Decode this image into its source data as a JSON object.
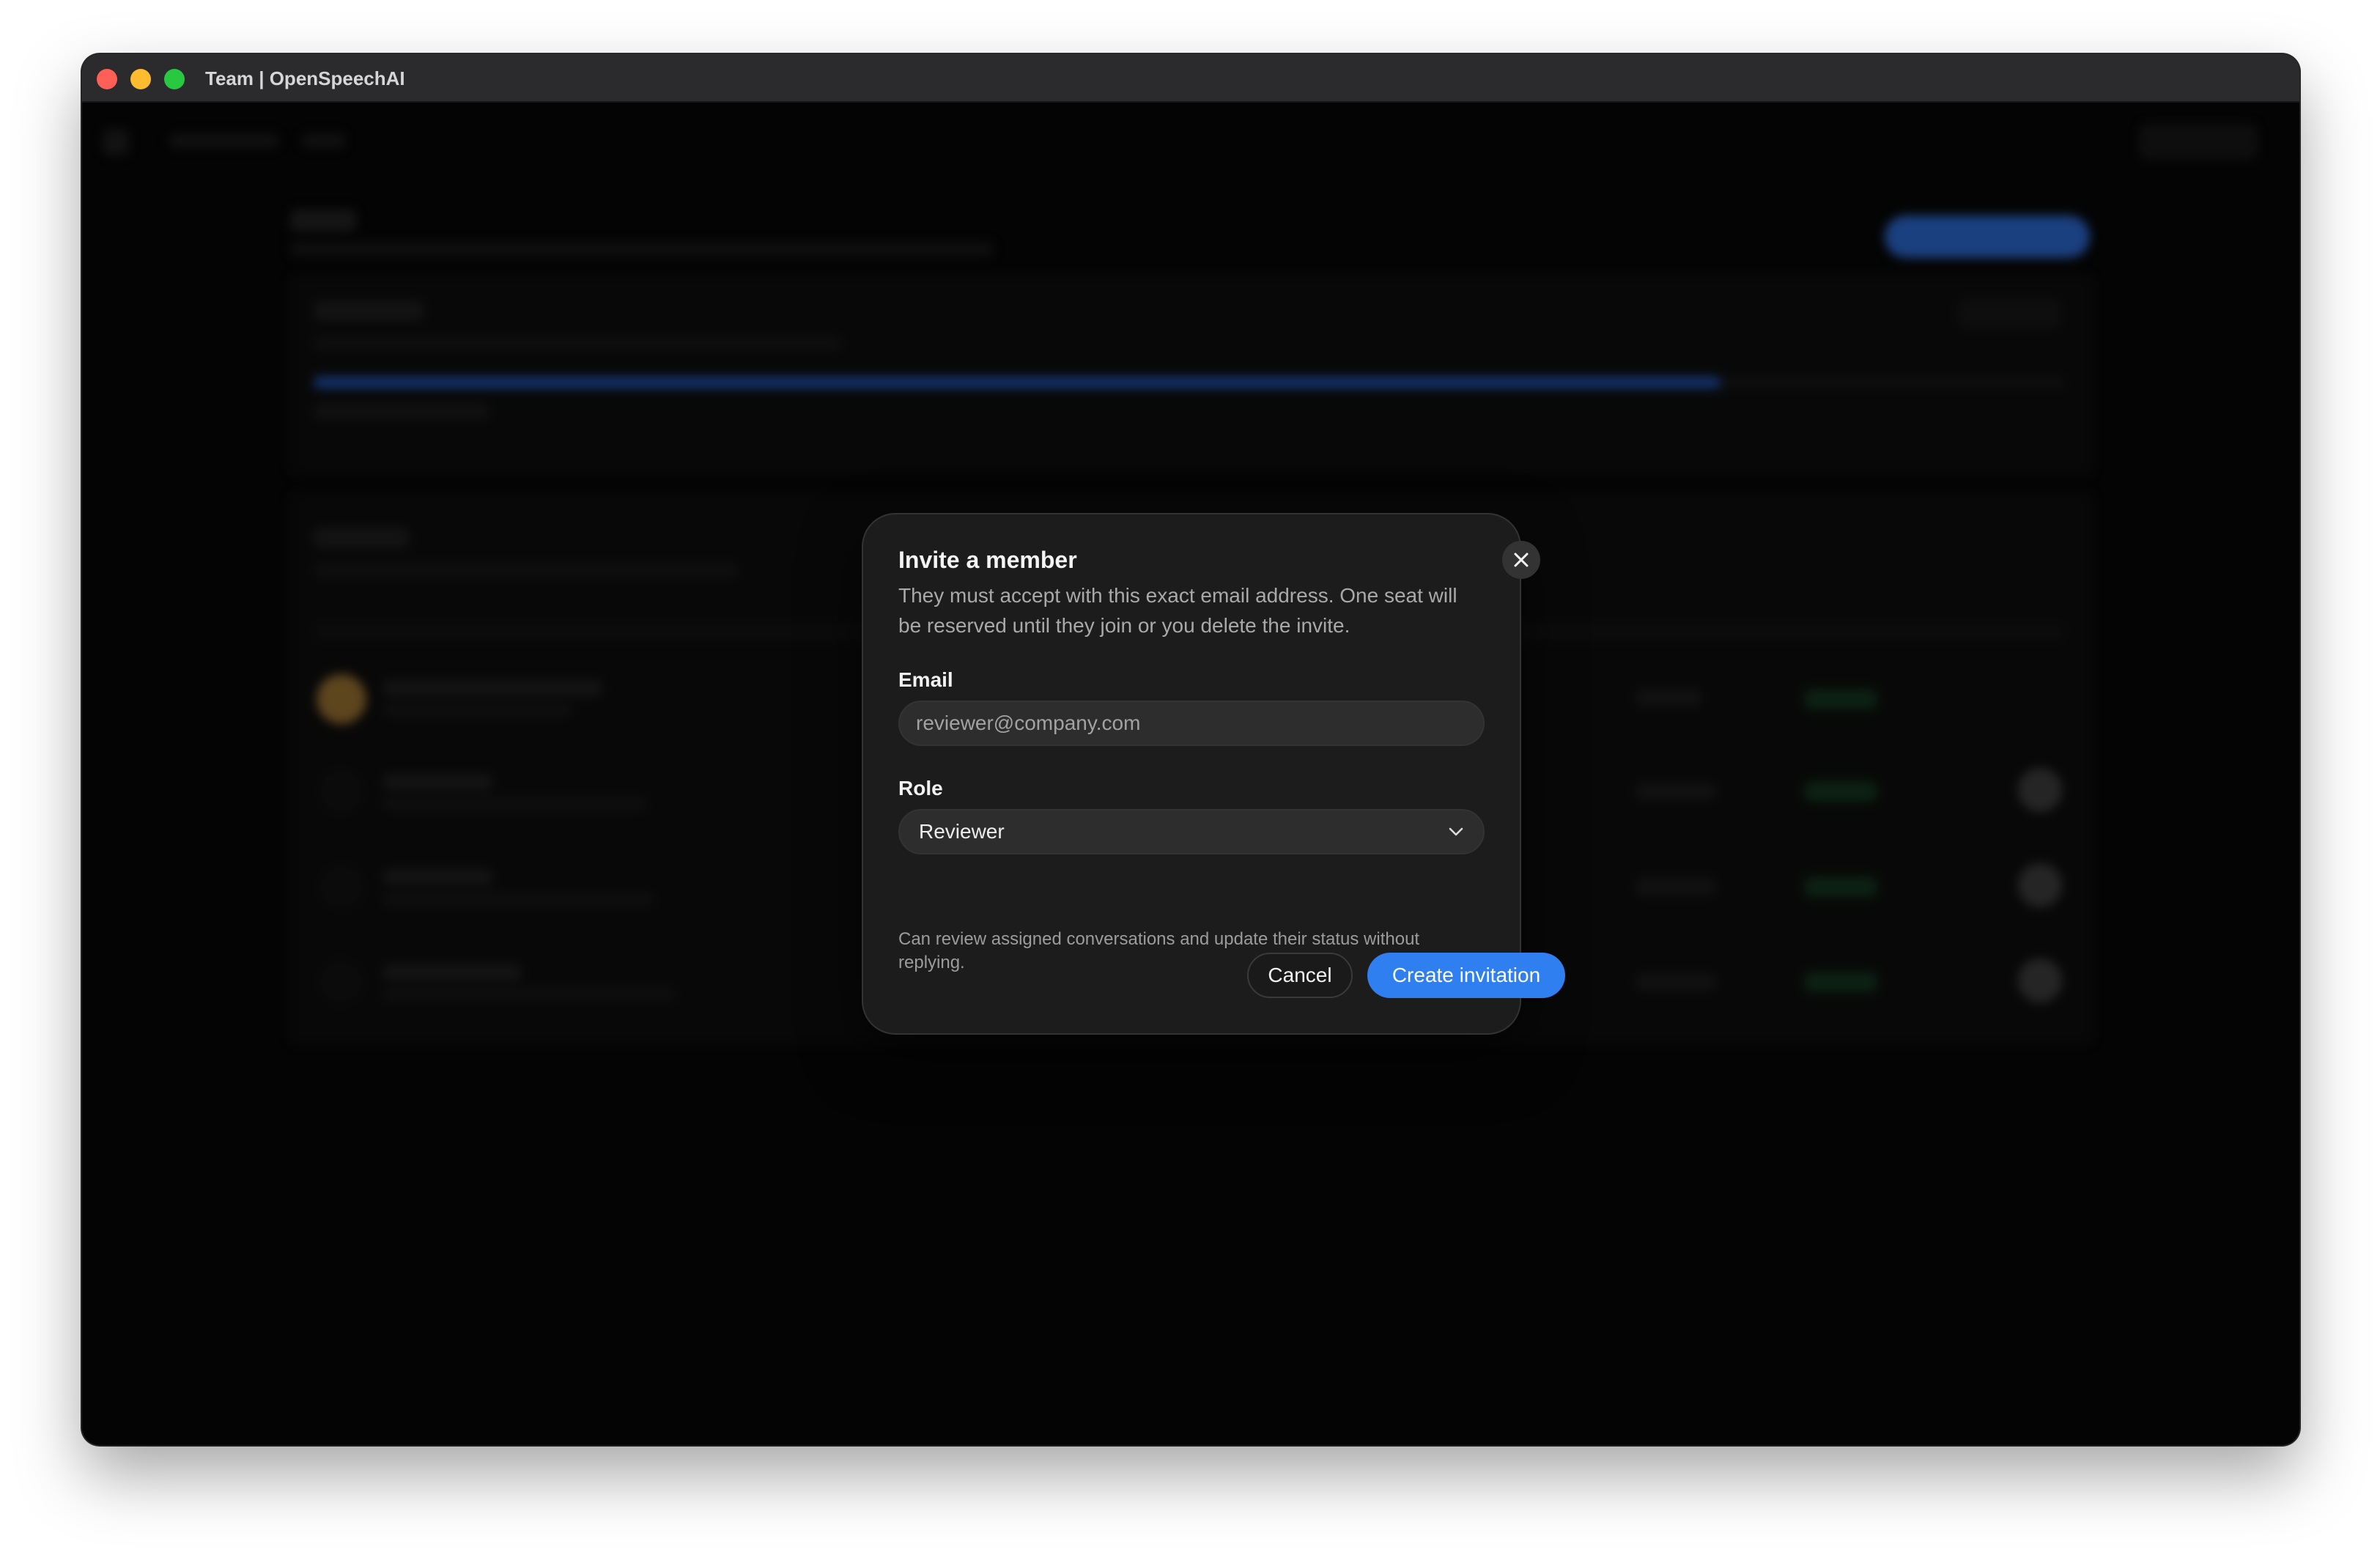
{
  "window": {
    "title": "Team | OpenSpeechAI"
  },
  "modal": {
    "title": "Invite a member",
    "description": "They must accept with this exact email address. One seat will be reserved until they join or you delete the invite.",
    "email": {
      "label": "Email",
      "placeholder": "reviewer@company.com",
      "value": ""
    },
    "role": {
      "label": "Role",
      "selected": "Reviewer",
      "helper": "Can review assigned conversations and update their status without replying."
    },
    "buttons": {
      "cancel": "Cancel",
      "create": "Create invitation"
    }
  },
  "colors": {
    "primary": "#2f7ff0",
    "modal_bg": "#1c1c1c",
    "window_bg": "#070707"
  },
  "icons": {
    "close": "close-icon",
    "dropdown": "chevron-down-icon"
  }
}
